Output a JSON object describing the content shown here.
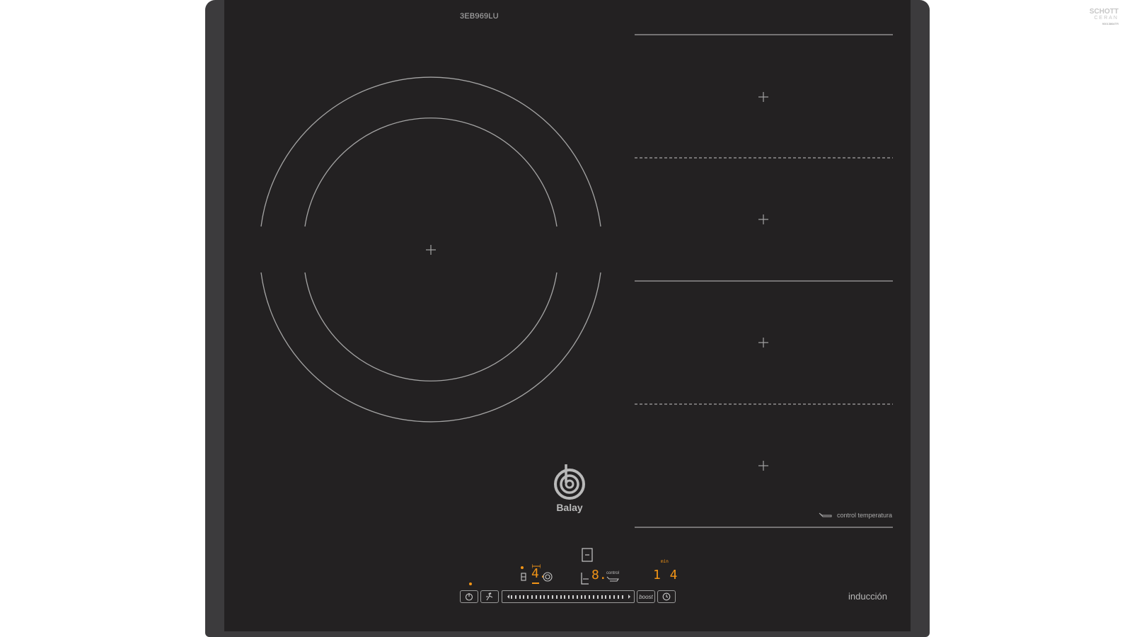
{
  "model": "3EB969LU",
  "brand_badge": {
    "line1": "SCHOTT",
    "line2": "CERAN",
    "line3": "90013864TR"
  },
  "logo": {
    "name": "balay-logo-icon",
    "text": "Balay"
  },
  "flex_zone": {
    "label": "control temperatura",
    "icon": "pan-sensor-icon"
  },
  "footer_label": "inducción",
  "controls": {
    "power_icon": "power-icon",
    "wipe_icon": "wipe-protect-icon",
    "boost_label": "boost",
    "timer_icon": "clock-icon",
    "zone_display": "4.",
    "flex_display": "8.",
    "flex_control_label": "control",
    "timer_display": "1 4",
    "timer_unit": "min"
  },
  "colors": {
    "glass": "#232122",
    "frame": "#3c3b3d",
    "display": "#f29416",
    "lines": "#9b9b9b"
  }
}
